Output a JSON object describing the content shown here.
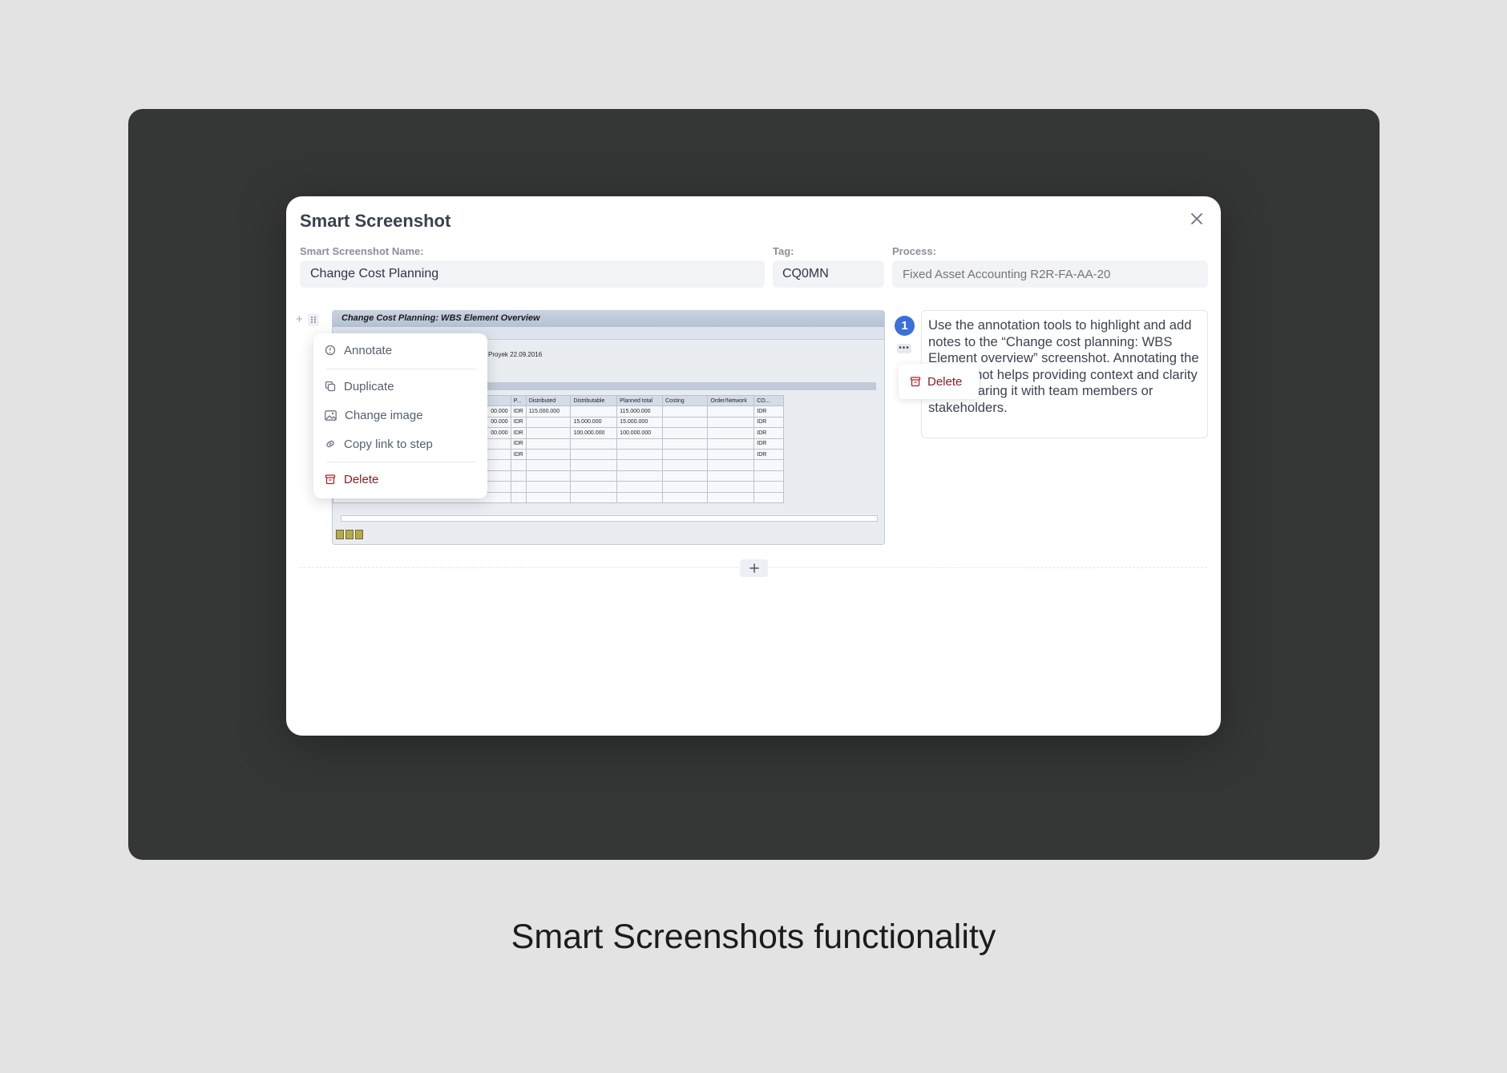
{
  "modal": {
    "title": "Smart Screenshot",
    "name_label": "Smart Screenshot Name:",
    "name_value": "Change Cost Planning",
    "tag_label": "Tag:",
    "tag_value": "CQ0MN",
    "process_label": "Process:",
    "process_placeholder": "Fixed Asset Accounting R2R-FA-AA-20"
  },
  "screenshot": {
    "window_title": "Change Cost Planning: WBS Element Overview",
    "info_text": "Proyek 22.09.2016",
    "columns": [
      "",
      "P...",
      "Distributed",
      "Distributable",
      "Planned total",
      "Costing",
      "Order/Network",
      "CO..."
    ],
    "rows": [
      [
        "00.000",
        "IDR",
        "115.000.000",
        "",
        "115.000.000",
        "",
        "",
        "IDR"
      ],
      [
        "00.000",
        "IDR",
        "",
        "15.000.000",
        "15.000.000",
        "",
        "",
        "IDR"
      ],
      [
        "00.000",
        "IDR",
        "",
        "100.000.000",
        "100.000.000",
        "",
        "",
        "IDR"
      ],
      [
        "",
        "IDR",
        "",
        "",
        "",
        "",
        "",
        "IDR"
      ],
      [
        "",
        "IDR",
        "",
        "",
        "",
        "",
        "",
        "IDR"
      ],
      [
        "",
        "",
        "",
        "",
        "",
        "",
        "",
        ""
      ],
      [
        "",
        "",
        "",
        "",
        "",
        "",
        "",
        ""
      ],
      [
        "",
        "",
        "",
        "",
        "",
        "",
        "",
        ""
      ],
      [
        "",
        "",
        "",
        "",
        "",
        "",
        "",
        ""
      ]
    ]
  },
  "context_menu": {
    "annotate": "Annotate",
    "duplicate": "Duplicate",
    "change_image": "Change image",
    "copy_link": "Copy link to step",
    "delete": "Delete"
  },
  "step": {
    "number": "1",
    "more": "•••",
    "note": "Use the annotation tools to highlight and add notes to the “Change cost planning: WBS Element overview” screenshot. Annotating the screenshot helps providing context and clarity when sharing it with team members or stakeholders.",
    "delete_label": "Delete"
  },
  "caption": "Smart Screenshots functionality",
  "colors": {
    "accent": "#3b6fd9",
    "danger": "#8a1c1c",
    "stage": "#353736",
    "background": "#e3e3e3"
  }
}
